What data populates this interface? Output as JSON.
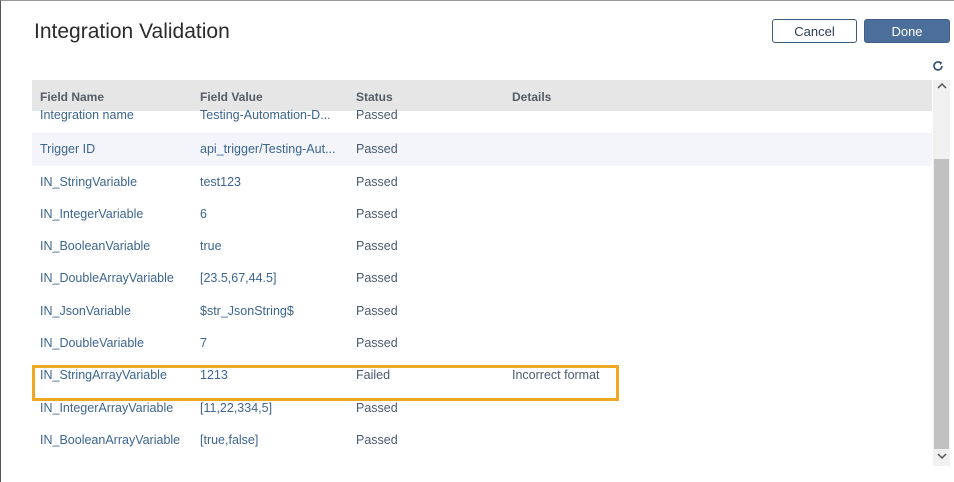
{
  "dialog": {
    "title": "Integration Validation",
    "cancel_label": "Cancel",
    "done_label": "Done",
    "refresh_icon": "refresh-icon"
  },
  "table": {
    "headers": {
      "field_name": "Field Name",
      "field_value": "Field Value",
      "status": "Status",
      "details": "Details"
    },
    "rows": [
      {
        "field_name": "Integration name",
        "field_value": "Testing-Automation-D...",
        "status": "Passed",
        "details": ""
      },
      {
        "field_name": "Trigger ID",
        "field_value": "api_trigger/Testing-Aut...",
        "status": "Passed",
        "details": ""
      },
      {
        "field_name": "IN_StringVariable",
        "field_value": "test123",
        "status": "Passed",
        "details": ""
      },
      {
        "field_name": "IN_IntegerVariable",
        "field_value": "6",
        "status": "Passed",
        "details": ""
      },
      {
        "field_name": "IN_BooleanVariable",
        "field_value": "true",
        "status": "Passed",
        "details": ""
      },
      {
        "field_name": "IN_DoubleArrayVariable",
        "field_value": "[23.5,67,44.5]",
        "status": "Passed",
        "details": ""
      },
      {
        "field_name": "IN_JsonVariable",
        "field_value": "$str_JsonString$",
        "status": "Passed",
        "details": ""
      },
      {
        "field_name": "IN_DoubleVariable",
        "field_value": "7",
        "status": "Passed",
        "details": ""
      },
      {
        "field_name": "IN_StringArrayVariable",
        "field_value": "1213",
        "status": "Failed",
        "details": "Incorrect format"
      },
      {
        "field_name": "IN_IntegerArrayVariable",
        "field_value": "[11,22,334,5]",
        "status": "Passed",
        "details": ""
      },
      {
        "field_name": "IN_BooleanArrayVariable",
        "field_value": "[true,false]",
        "status": "Passed",
        "details": ""
      }
    ]
  },
  "colors": {
    "highlight": "#f0a823",
    "done_button": "#4b6e9a",
    "link_text": "#3c6591"
  }
}
